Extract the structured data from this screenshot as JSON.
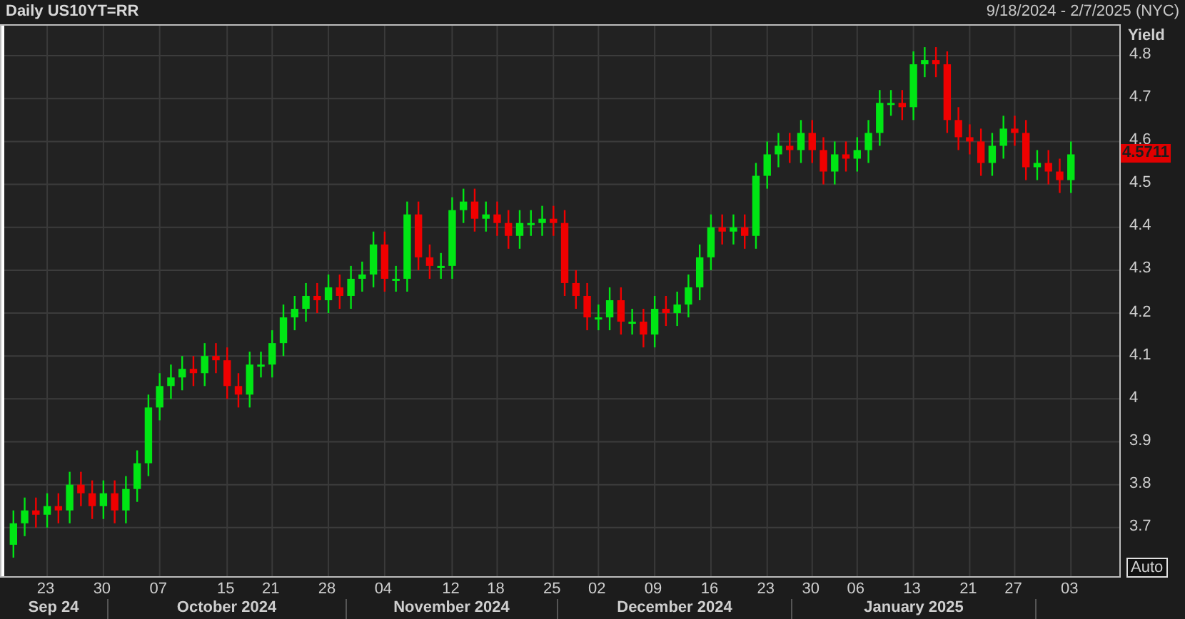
{
  "header": {
    "title": "Daily US10YT=RR",
    "date_range": "9/18/2024 - 2/7/2025 (NYC)"
  },
  "chart": {
    "chart_data": {
      "type": "candlestick",
      "ylabel": "Yield",
      "grid": true,
      "ylim": [
        3.58,
        4.87
      ],
      "yticks": [
        3.7,
        3.8,
        3.9,
        4,
        4.1,
        4.2,
        4.3,
        4.4,
        4.5,
        4.6,
        4.7,
        4.8
      ],
      "categories": [
        null,
        null,
        null,
        "23",
        null,
        null,
        null,
        null,
        "30",
        null,
        null,
        null,
        null,
        "07",
        null,
        null,
        null,
        null,
        null,
        "15",
        null,
        null,
        null,
        "21",
        null,
        null,
        null,
        null,
        "28",
        null,
        null,
        null,
        null,
        "04",
        null,
        null,
        null,
        null,
        null,
        "12",
        null,
        null,
        null,
        "18",
        null,
        null,
        null,
        null,
        "25",
        null,
        null,
        null,
        "02",
        null,
        null,
        null,
        null,
        "09",
        null,
        null,
        null,
        null,
        "16",
        null,
        null,
        null,
        null,
        "23",
        null,
        null,
        null,
        "30",
        null,
        null,
        null,
        "06",
        null,
        null,
        null,
        null,
        "13",
        null,
        null,
        null,
        null,
        "21",
        null,
        null,
        null,
        "27",
        null,
        null,
        null,
        null,
        "03"
      ],
      "ohlc": [
        [
          3.66,
          3.74,
          3.63,
          3.71
        ],
        [
          3.71,
          3.77,
          3.68,
          3.74
        ],
        [
          3.74,
          3.77,
          3.7,
          3.73
        ],
        [
          3.73,
          3.78,
          3.7,
          3.75
        ],
        [
          3.75,
          3.78,
          3.71,
          3.74
        ],
        [
          3.74,
          3.83,
          3.71,
          3.8
        ],
        [
          3.8,
          3.83,
          3.75,
          3.78
        ],
        [
          3.78,
          3.81,
          3.72,
          3.75
        ],
        [
          3.75,
          3.81,
          3.72,
          3.78
        ],
        [
          3.78,
          3.81,
          3.71,
          3.74
        ],
        [
          3.74,
          3.82,
          3.71,
          3.79
        ],
        [
          3.79,
          3.88,
          3.76,
          3.85
        ],
        [
          3.85,
          4.01,
          3.82,
          3.98
        ],
        [
          3.98,
          4.06,
          3.95,
          4.03
        ],
        [
          4.03,
          4.08,
          4.0,
          4.05
        ],
        [
          4.05,
          4.1,
          4.02,
          4.07
        ],
        [
          4.07,
          4.1,
          4.03,
          4.06
        ],
        [
          4.06,
          4.13,
          4.03,
          4.1
        ],
        [
          4.1,
          4.13,
          4.06,
          4.09
        ],
        [
          4.09,
          4.12,
          4.0,
          4.03
        ],
        [
          4.03,
          4.06,
          3.98,
          4.01
        ],
        [
          4.01,
          4.11,
          3.98,
          4.08
        ],
        [
          4.08,
          4.11,
          4.05,
          4.08
        ],
        [
          4.08,
          4.16,
          4.05,
          4.13
        ],
        [
          4.13,
          4.22,
          4.1,
          4.19
        ],
        [
          4.19,
          4.24,
          4.16,
          4.21
        ],
        [
          4.21,
          4.27,
          4.18,
          4.24
        ],
        [
          4.24,
          4.27,
          4.2,
          4.23
        ],
        [
          4.23,
          4.29,
          4.2,
          4.26
        ],
        [
          4.26,
          4.29,
          4.21,
          4.24
        ],
        [
          4.24,
          4.31,
          4.21,
          4.28
        ],
        [
          4.28,
          4.32,
          4.25,
          4.29
        ],
        [
          4.29,
          4.39,
          4.26,
          4.36
        ],
        [
          4.36,
          4.39,
          4.25,
          4.28
        ],
        [
          4.28,
          4.31,
          4.25,
          4.28
        ],
        [
          4.28,
          4.46,
          4.25,
          4.43
        ],
        [
          4.43,
          4.46,
          4.3,
          4.33
        ],
        [
          4.33,
          4.36,
          4.28,
          4.31
        ],
        [
          4.31,
          4.34,
          4.28,
          4.31
        ],
        [
          4.31,
          4.47,
          4.28,
          4.44
        ],
        [
          4.44,
          4.49,
          4.41,
          4.46
        ],
        [
          4.46,
          4.49,
          4.39,
          4.42
        ],
        [
          4.42,
          4.46,
          4.39,
          4.43
        ],
        [
          4.43,
          4.46,
          4.38,
          4.41
        ],
        [
          4.41,
          4.44,
          4.35,
          4.38
        ],
        [
          4.38,
          4.44,
          4.35,
          4.41
        ],
        [
          4.41,
          4.44,
          4.38,
          4.41
        ],
        [
          4.41,
          4.45,
          4.38,
          4.42
        ],
        [
          4.42,
          4.45,
          4.38,
          4.41
        ],
        [
          4.41,
          4.44,
          4.24,
          4.27
        ],
        [
          4.27,
          4.3,
          4.21,
          4.24
        ],
        [
          4.24,
          4.27,
          4.16,
          4.19
        ],
        [
          4.19,
          4.22,
          4.16,
          4.19
        ],
        [
          4.19,
          4.26,
          4.16,
          4.23
        ],
        [
          4.23,
          4.26,
          4.15,
          4.18
        ],
        [
          4.18,
          4.21,
          4.15,
          4.18
        ],
        [
          4.18,
          4.21,
          4.12,
          4.15
        ],
        [
          4.15,
          4.24,
          4.12,
          4.21
        ],
        [
          4.21,
          4.24,
          4.17,
          4.2
        ],
        [
          4.2,
          4.25,
          4.17,
          4.22
        ],
        [
          4.22,
          4.29,
          4.19,
          4.26
        ],
        [
          4.26,
          4.36,
          4.23,
          4.33
        ],
        [
          4.33,
          4.43,
          4.3,
          4.4
        ],
        [
          4.4,
          4.43,
          4.36,
          4.39
        ],
        [
          4.39,
          4.43,
          4.36,
          4.4
        ],
        [
          4.4,
          4.43,
          4.35,
          4.38
        ],
        [
          4.38,
          4.55,
          4.35,
          4.52
        ],
        [
          4.52,
          4.6,
          4.49,
          4.57
        ],
        [
          4.57,
          4.62,
          4.54,
          4.59
        ],
        [
          4.59,
          4.62,
          4.55,
          4.58
        ],
        [
          4.58,
          4.65,
          4.55,
          4.62
        ],
        [
          4.62,
          4.65,
          4.55,
          4.58
        ],
        [
          4.58,
          4.61,
          4.5,
          4.53
        ],
        [
          4.53,
          4.6,
          4.5,
          4.57
        ],
        [
          4.57,
          4.6,
          4.53,
          4.56
        ],
        [
          4.56,
          4.61,
          4.53,
          4.58
        ],
        [
          4.58,
          4.65,
          4.55,
          4.62
        ],
        [
          4.62,
          4.72,
          4.59,
          4.69
        ],
        [
          4.69,
          4.72,
          4.66,
          4.69
        ],
        [
          4.69,
          4.72,
          4.65,
          4.68
        ],
        [
          4.68,
          4.81,
          4.65,
          4.78
        ],
        [
          4.78,
          4.82,
          4.75,
          4.79
        ],
        [
          4.79,
          4.82,
          4.75,
          4.78
        ],
        [
          4.78,
          4.81,
          4.62,
          4.65
        ],
        [
          4.65,
          4.68,
          4.58,
          4.61
        ],
        [
          4.61,
          4.64,
          4.57,
          4.6
        ],
        [
          4.6,
          4.63,
          4.52,
          4.55
        ],
        [
          4.55,
          4.62,
          4.52,
          4.59
        ],
        [
          4.59,
          4.66,
          4.56,
          4.63
        ],
        [
          4.63,
          4.66,
          4.59,
          4.62
        ],
        [
          4.62,
          4.65,
          4.51,
          4.54
        ],
        [
          4.54,
          4.58,
          4.51,
          4.55
        ],
        [
          4.55,
          4.58,
          4.5,
          4.53
        ],
        [
          4.53,
          4.56,
          4.48,
          4.51
        ],
        [
          4.51,
          4.6,
          4.48,
          4.57
        ]
      ],
      "annotations": [
        "4.5711"
      ]
    },
    "months": [
      "Sep 24",
      "October 2024",
      "November 2024",
      "December 2024",
      "January 2025"
    ],
    "auto_button": "Auto"
  }
}
